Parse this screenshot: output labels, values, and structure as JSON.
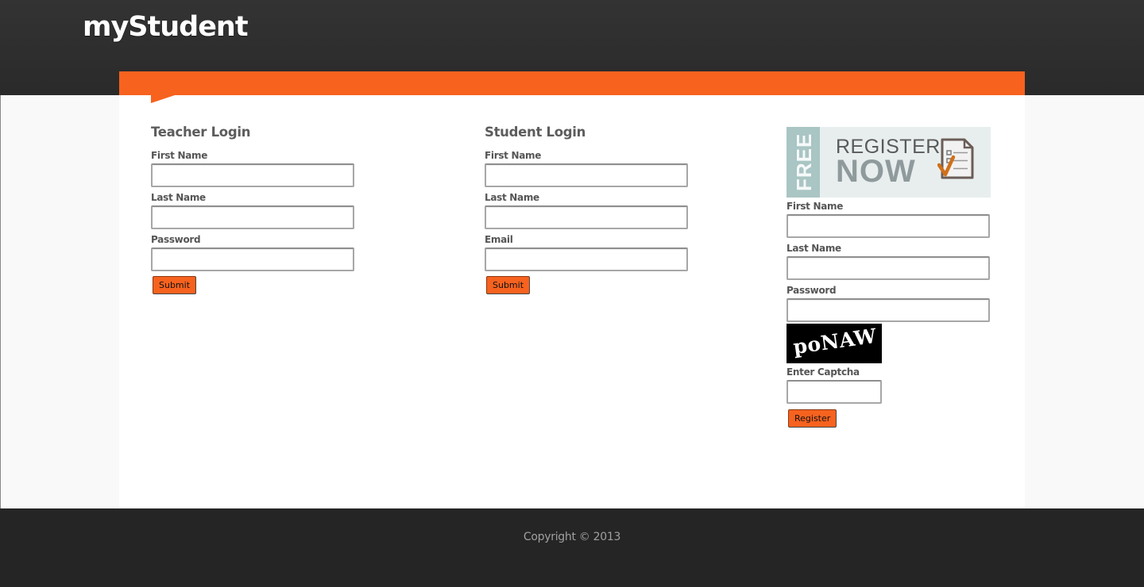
{
  "brand": "myStudent",
  "teacher_login": {
    "title": "Teacher Login",
    "fields": [
      {
        "label": "First Name",
        "value": ""
      },
      {
        "label": "Last Name",
        "value": ""
      },
      {
        "label": "Password",
        "value": ""
      }
    ],
    "submit_label": "Submit"
  },
  "student_login": {
    "title": "Student Login",
    "fields": [
      {
        "label": "First Name",
        "value": ""
      },
      {
        "label": "Last Name",
        "value": ""
      },
      {
        "label": "Email",
        "value": ""
      }
    ],
    "submit_label": "Submit"
  },
  "register": {
    "banner": {
      "free": "FREE",
      "register": "REGISTER",
      "now": "NOW"
    },
    "fields": [
      {
        "label": "First Name",
        "value": ""
      },
      {
        "label": "Last Name",
        "value": ""
      },
      {
        "label": "Password",
        "value": ""
      }
    ],
    "captcha_text": "poNAW",
    "captcha_label": "Enter Captcha",
    "captcha_value": "",
    "submit_label": "Register"
  },
  "footer": {
    "copyright": "Copyright © 2013"
  },
  "colors": {
    "accent": "#f7621f",
    "header_bg": "#2d2d2d",
    "footer_bg": "#252525"
  }
}
